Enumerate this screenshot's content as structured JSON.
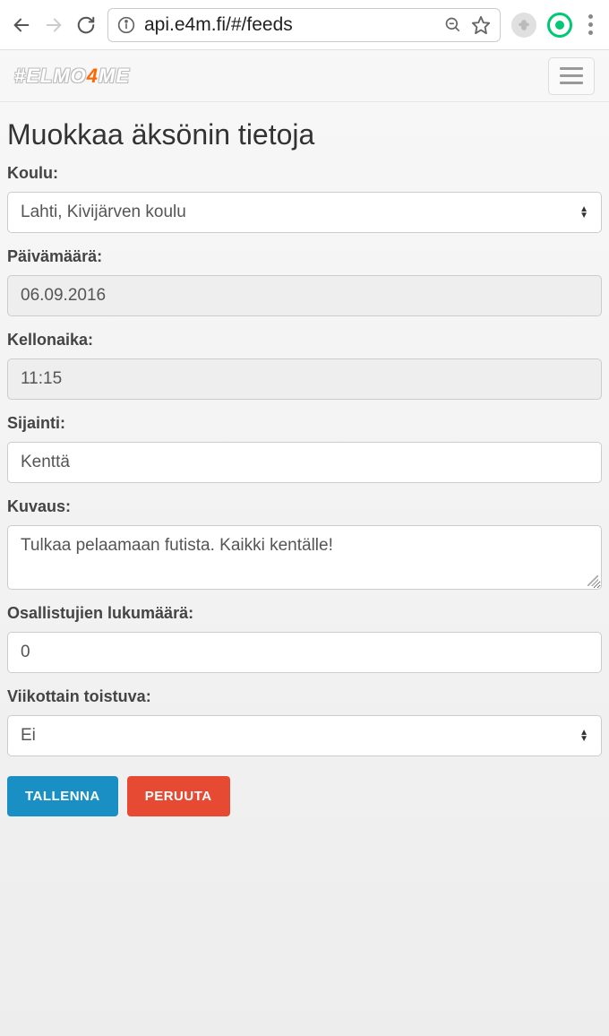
{
  "browser": {
    "url": "api.e4m.fi/#/feeds"
  },
  "logo_prefix": "#ELMO",
  "logo_highlight": "4",
  "logo_suffix": "ME",
  "page_title": "Muokkaa äksönin tietoja",
  "form": {
    "school": {
      "label": "Koulu:",
      "value": "Lahti, Kivijärven koulu"
    },
    "date": {
      "label": "Päivämäärä:",
      "value": "06.09.2016"
    },
    "time": {
      "label": "Kellonaika:",
      "value": "11:15"
    },
    "location": {
      "label": "Sijainti:",
      "value": "Kenttä"
    },
    "description": {
      "label": "Kuvaus:",
      "value": "Tulkaa pelaamaan futista. Kaikki kentälle!"
    },
    "participants": {
      "label": "Osallistujien lukumäärä:",
      "value": "0"
    },
    "weekly": {
      "label": "Viikottain toistuva:",
      "value": "Ei"
    }
  },
  "buttons": {
    "save": "TALLENNA",
    "cancel": "PERUUTA"
  }
}
